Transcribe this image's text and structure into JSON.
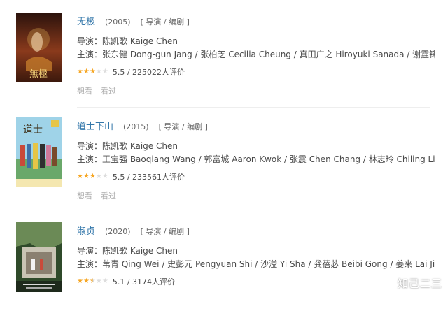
{
  "movies": [
    {
      "title": "无极",
      "year": "(2005)",
      "roles": "[ 导演 / 编剧 ]",
      "director": "导演：陈凯歌 Kaige Chen",
      "cast": "主演：张东健 Dong-gun Jang / 张柏芝 Cecilia Cheung / 真田广之 Hiroyuki Sanada / 谢霆锋 Nicho...",
      "rating_stars": 3,
      "rating_text": "5.5 / 225022人评价",
      "want": "想看",
      "seen": "看过",
      "poster_colors": [
        "#2a120c",
        "#8a3a1c",
        "#d7a64c"
      ],
      "poster_glyph": "無極"
    },
    {
      "title": "道士下山",
      "year": "(2015)",
      "roles": "[ 导演 / 编剧 ]",
      "director": "导演：陈凯歌 Kaige Chen",
      "cast": "主演：王宝强 Baoqiang Wang / 郭富城 Aaron Kwok / 张震 Chen Chang / 林志玲 Chiling Lin / 范伟...",
      "rating_stars": 3,
      "rating_text": "5.5 / 233561人评价",
      "want": "想看",
      "seen": "看过",
      "poster_colors": [
        "#9fd3e8",
        "#e6c547",
        "#3f6fa8"
      ],
      "poster_glyph": "道士"
    },
    {
      "title": "淑贞",
      "year": "(2020)",
      "roles": "[ 导演 / 编剧 ]",
      "director": "导演：陈凯歌 Kaige Chen",
      "cast": "主演：苇青 Qing Wei / 史彭元 Pengyuan Shi / 沙溢 Yi Sha / 龚蓓苾 Beibi Gong / 姜来 Lai Jiang / ...",
      "rating_stars": 2.5,
      "rating_text": "5.1 / 3174人评价",
      "poster_colors": [
        "#2f4a2a",
        "#6b8a56",
        "#c9c4b4"
      ],
      "poster_glyph": ""
    }
  ],
  "watermark": "知己二三",
  "colors": {
    "link": "#3377aa",
    "star": "#f6a623",
    "divider": "#eeeeee"
  }
}
